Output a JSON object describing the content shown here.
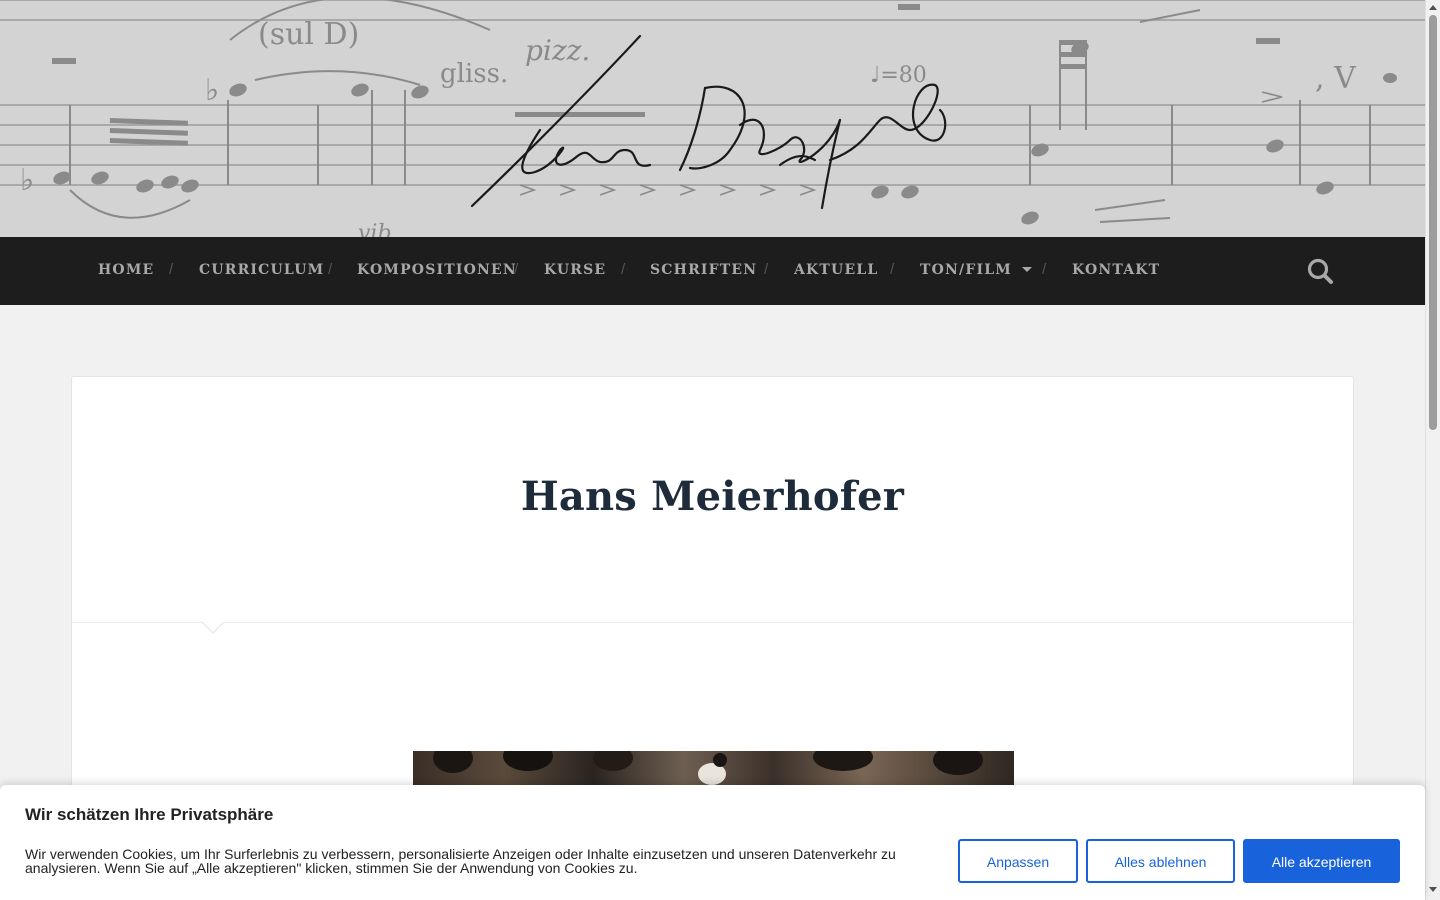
{
  "nav": {
    "items": [
      {
        "label": "HOME"
      },
      {
        "label": "CURRICULUM"
      },
      {
        "label": "KOMPOSITIONEN"
      },
      {
        "label": "KURSE"
      },
      {
        "label": "SCHRIFTEN"
      },
      {
        "label": "AKTUELL"
      },
      {
        "label": "TON/FILM"
      },
      {
        "label": "KONTAKT"
      }
    ],
    "separator": "/",
    "search_icon": "search-icon",
    "dropdown_icon": "caret-down-icon"
  },
  "banner": {
    "score_marks": {
      "sul_d": "(sul D)",
      "gliss": "gliss.",
      "pizz": "pizz.",
      "tempo": "♩=80",
      "vib": "vib"
    }
  },
  "page": {
    "title": "Hans Meierhofer"
  },
  "cookie": {
    "title": "Wir schätzen Ihre Privatsphäre",
    "text": "Wir verwenden Cookies, um Ihr Surferlebnis zu verbessern, personalisierte Anzeigen oder Inhalte einzusetzen und unseren Datenverkehr zu analysieren. Wenn Sie auf „Alle akzeptieren\" klicken, stimmen Sie der Anwendung von Cookies zu.",
    "customize_label": "Anpassen",
    "reject_label": "Alles ablehnen",
    "accept_label": "Alle akzeptieren"
  },
  "colors": {
    "nav_bg": "#1d1d1d",
    "accent": "#1863dc",
    "title": "#1e2b3a"
  }
}
